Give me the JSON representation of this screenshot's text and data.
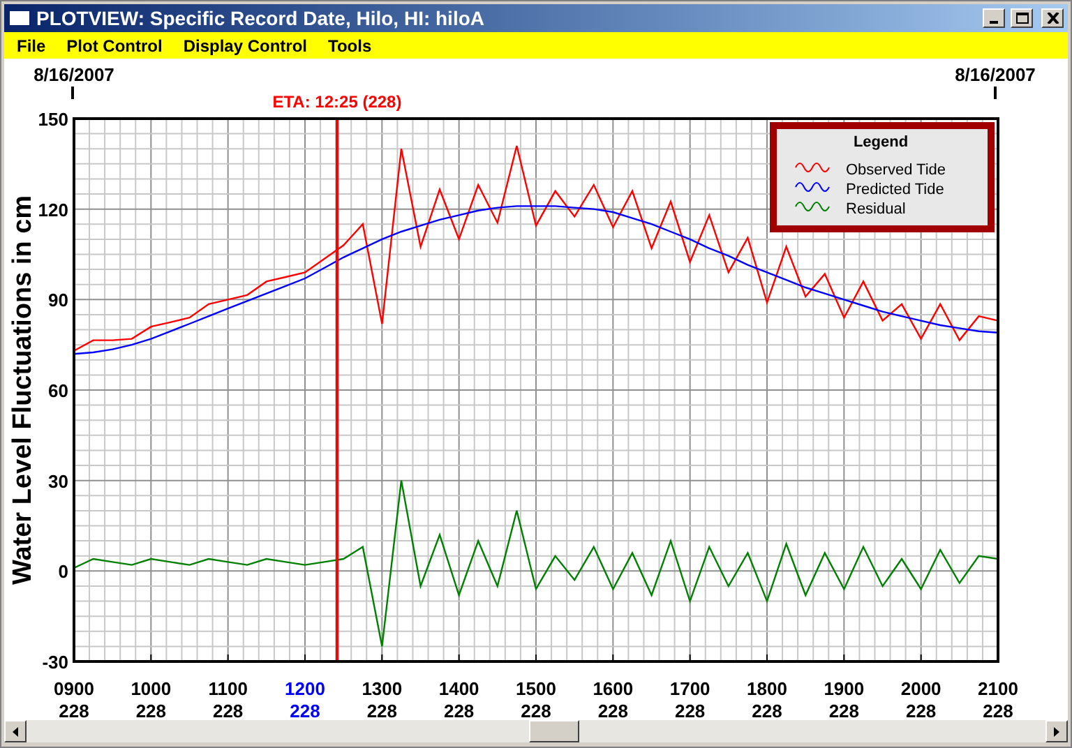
{
  "window": {
    "title": "PLOTVIEW: Specific Record Date, Hilo, HI: hiloA"
  },
  "menu": [
    "File",
    "Plot Control",
    "Display Control",
    "Tools"
  ],
  "date_left": "8/16/2007",
  "date_right": "8/16/2007",
  "day_labels": [
    {
      "day": "228",
      "highlighted": false
    },
    {
      "day": "228",
      "highlighted": false
    },
    {
      "day": "228",
      "highlighted": false
    },
    {
      "day": "228",
      "highlighted": true
    },
    {
      "day": "228",
      "highlighted": false
    },
    {
      "day": "228",
      "highlighted": false
    },
    {
      "day": "228",
      "highlighted": false
    },
    {
      "day": "228",
      "highlighted": false
    },
    {
      "day": "228",
      "highlighted": false
    },
    {
      "day": "228",
      "highlighted": false
    },
    {
      "day": "228",
      "highlighted": false
    },
    {
      "day": "228",
      "highlighted": false
    },
    {
      "day": "228",
      "highlighted": false
    }
  ],
  "chart_data": {
    "type": "line",
    "ylabel": "Water Level Fluctuations in cm",
    "legend_title": "Legend",
    "categories": [
      "0900",
      null,
      null,
      null,
      "1000",
      null,
      null,
      null,
      "1100",
      null,
      null,
      null,
      "1200",
      null,
      null,
      null,
      "1300",
      null,
      null,
      null,
      "1400",
      null,
      null,
      null,
      "1500",
      null,
      null,
      null,
      "1600",
      null,
      null,
      null,
      "1700",
      null,
      null,
      null,
      "1800",
      null,
      null,
      null,
      "1900",
      null,
      null,
      null,
      "2000",
      null,
      null,
      null,
      "2100"
    ],
    "grid": true,
    "legend": "upper right",
    "series": [
      {
        "name": "Observed Tide",
        "color": "#ff0000",
        "values": [
          73,
          76.5,
          76.5,
          77,
          81,
          82.5,
          84,
          88.5,
          90,
          91.5,
          96,
          97.5,
          99,
          103.5,
          108,
          115,
          82,
          140,
          107.5,
          126.5,
          110,
          128,
          115.5,
          141,
          114.5,
          126,
          117.5,
          128,
          114,
          126,
          107,
          122.5,
          102.5,
          118,
          99,
          110.5,
          89,
          107.5,
          91,
          98.5,
          84,
          96,
          83,
          88.5,
          77,
          88.5,
          76.5,
          84.5,
          83
        ]
      },
      {
        "name": "Predicted Tide",
        "color": "#0000ff",
        "values": [
          72,
          72.5,
          73.5,
          75,
          77,
          79.5,
          82,
          84.5,
          87,
          89.5,
          92,
          94.5,
          97,
          100.5,
          104,
          107,
          110,
          112.5,
          114.5,
          116.5,
          118,
          119.5,
          120.5,
          121,
          121,
          121,
          120.5,
          120,
          119,
          117,
          115,
          112.5,
          110,
          107,
          104.5,
          101.5,
          99,
          96.5,
          94,
          92,
          90,
          88,
          86,
          84.5,
          83,
          81.5,
          80.5,
          79.5,
          79
        ]
      },
      {
        "name": "Residual",
        "color": "#008000",
        "values": [
          1,
          4,
          3,
          2,
          4,
          3,
          2,
          4,
          3,
          2,
          4,
          3,
          2,
          3,
          4,
          8,
          -25,
          30,
          -5,
          12,
          -8,
          10,
          -5,
          20,
          -6,
          5,
          -3,
          8,
          -6,
          6,
          -8,
          10,
          -10,
          8,
          -5,
          6,
          -10,
          9,
          -8,
          6,
          -6,
          8,
          -5,
          4,
          -6,
          7,
          -4,
          5,
          4
        ]
      }
    ],
    "ylim": [
      -30,
      150
    ],
    "yticks": [
      {
        "value": -30,
        "label": "-30"
      },
      {
        "value": 0,
        "label": "0"
      },
      {
        "value": 30,
        "label": "30"
      },
      {
        "value": 60,
        "label": "60"
      },
      {
        "value": 90,
        "label": "90"
      },
      {
        "value": 120,
        "label": "120"
      },
      {
        "value": 150,
        "label": "150"
      }
    ],
    "annotations": [
      "ETA: 12:25 (228)"
    ]
  }
}
